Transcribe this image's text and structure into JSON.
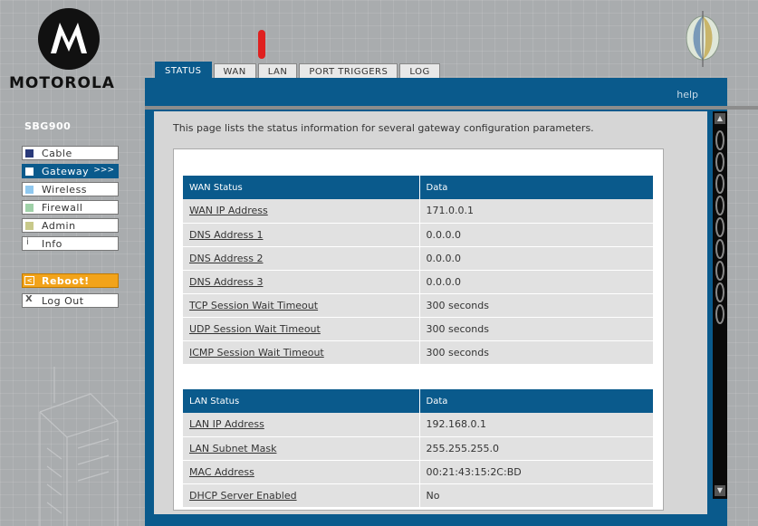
{
  "brand": {
    "name": "MOTOROLA",
    "model": "SBG900"
  },
  "tabs": [
    {
      "label": "STATUS",
      "active": true
    },
    {
      "label": "WAN",
      "active": false
    },
    {
      "label": "LAN",
      "active": false
    },
    {
      "label": "PORT TRIGGERS",
      "active": false
    },
    {
      "label": "LOG",
      "active": false
    }
  ],
  "header": {
    "help": "help"
  },
  "sidebar": {
    "items": [
      {
        "label": "Cable",
        "color": "#2a3a7a",
        "active": false
      },
      {
        "label": "Gateway",
        "color": "#ffffff",
        "active": true,
        "arrow": ">>>"
      },
      {
        "label": "Wireless",
        "color": "#8fc8ef",
        "active": false
      },
      {
        "label": "Firewall",
        "color": "#9fd1a8",
        "active": false
      },
      {
        "label": "Admin",
        "color": "#c8c98a",
        "active": false
      },
      {
        "label": "Info",
        "icon": "info-icon",
        "active": false
      }
    ],
    "reboot": "Reboot!",
    "logout": "Log Out"
  },
  "main": {
    "intro": "This page lists the status information for several gateway configuration parameters.",
    "wan": {
      "headers": [
        "WAN Status",
        "Data"
      ],
      "rows": [
        [
          "WAN IP Address",
          "171.0.0.1"
        ],
        [
          "DNS Address 1",
          "0.0.0.0"
        ],
        [
          "DNS Address 2",
          "0.0.0.0"
        ],
        [
          "DNS Address 3",
          "0.0.0.0"
        ],
        [
          "TCP Session Wait Timeout",
          "300 seconds"
        ],
        [
          "UDP Session Wait Timeout",
          "300 seconds"
        ],
        [
          "ICMP Session Wait Timeout",
          "300 seconds"
        ]
      ]
    },
    "lan": {
      "headers": [
        "LAN Status",
        "Data"
      ],
      "rows": [
        [
          "LAN IP Address",
          "192.168.0.1"
        ],
        [
          "LAN Subnet Mask",
          "255.255.255.0"
        ],
        [
          "MAC Address",
          "00:21:43:15:2C:BD"
        ],
        [
          "DHCP Server Enabled",
          "No"
        ]
      ]
    }
  }
}
